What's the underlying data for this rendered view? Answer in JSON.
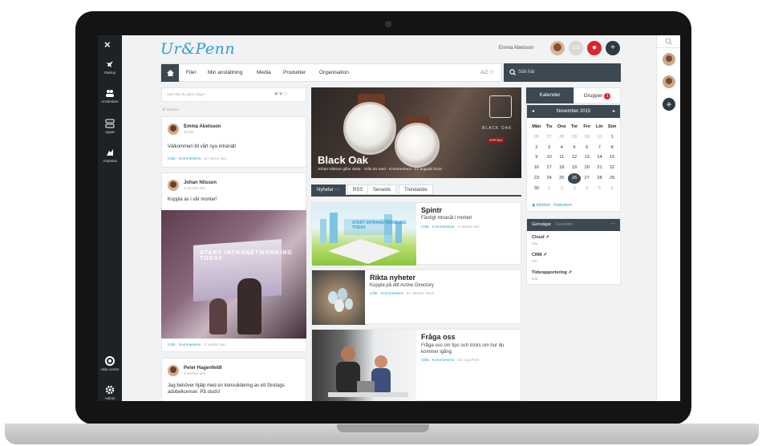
{
  "app": {
    "logo": "Ur&Penn"
  },
  "sidebar": {
    "close": "×",
    "items": [
      {
        "label": "Startup",
        "icon": "rocket-icon"
      },
      {
        "label": "Användare",
        "icon": "users-icon"
      },
      {
        "label": "Appar",
        "icon": "apps-icon"
      },
      {
        "label": "Anpassa",
        "icon": "customize-icon"
      },
      {
        "label": "Help center",
        "icon": "help-icon"
      },
      {
        "label": "Admin",
        "icon": "gear-icon"
      }
    ]
  },
  "header": {
    "user_name": "Emma Abelsson ·"
  },
  "nav": {
    "items": [
      "Filer",
      "Min anställning",
      "Media",
      "Produkter",
      "Organisation"
    ],
    "tools": "A/Z  ⚇",
    "search_placeholder": "Sök här"
  },
  "composer": {
    "placeholder": "Vad ska du göra idag?",
    "sort_label": "⇵ Sortera"
  },
  "posts": [
    {
      "author": "Emma Abelsson",
      "time": "14:58",
      "text": "Välkommen till vårt nya intranät!",
      "like": "Gilla",
      "comment": "Kommentera",
      "age": "en minut sen"
    },
    {
      "author": "Johan Nilsson",
      "time": "2 veckor sen",
      "text": "Koppla av i vår monter!",
      "like": "Gilla",
      "comment": "Kommentera",
      "age": "2 veckor sen",
      "photo_text": "START INTRANETWORKING TODAY"
    },
    {
      "author": "Peter Hagenfeldt",
      "time": "5 veckor sen",
      "text": "Jag behöver hjälp med en konsolidering av ett företags adobelicenser. På studs!"
    }
  ],
  "hero": {
    "title": "Black Oak",
    "caption": "Johan Nilsson gillar detta · Gilla du med · Kommentera · 21 augusti 2015",
    "brand": "BLACK OAK",
    "buy": "KÖP NU!"
  },
  "news_tabs": [
    {
      "label": "Nyheter ⋯",
      "active": true
    },
    {
      "label": "RSS",
      "active": false
    },
    {
      "label": "Senaste",
      "active": false
    },
    {
      "label": "Trendande",
      "active": false
    }
  ],
  "news": [
    {
      "title": "Spintr",
      "desc": "Färdigt intranät i molnet",
      "like": "Gilla",
      "comment": "Kommentera",
      "age": "2 veckor sen",
      "img_text": "START INTRANETWORKING TODAY"
    },
    {
      "title": "Rikta nyheter",
      "desc": "Koppla på ditt Active Directory",
      "like": "Gilla",
      "comment": "Kommentera",
      "age": "21 oktober 2015"
    },
    {
      "title": "Fråga oss",
      "desc": "Fråga oss om tips och tricks om hur du kommer igång",
      "like": "Gilla",
      "comment": "Kommentera",
      "age": "25 maj 2015"
    }
  ],
  "calendar": {
    "tab_calendar": "Kalender",
    "tab_groups": "Grupper",
    "groups_badge": "1",
    "month": "November 2015",
    "prev": "◂",
    "next": "▸",
    "weekdays": [
      "Mån",
      "Tis",
      "Ons",
      "Tor",
      "Fre",
      "Lör",
      "Sön"
    ],
    "weeks": [
      [
        "26",
        "27",
        "28",
        "29",
        "30",
        "31",
        "1"
      ],
      [
        "2",
        "3",
        "4",
        "5",
        "6",
        "7",
        "8"
      ],
      [
        "9",
        "10",
        "11",
        "12",
        "13",
        "14",
        "15"
      ],
      [
        "16",
        "17",
        "18",
        "19",
        "20",
        "21",
        "22"
      ],
      [
        "23",
        "24",
        "25",
        "26",
        "27",
        "28",
        "29"
      ],
      [
        "30",
        "1",
        "2",
        "3",
        "4",
        "5",
        "6"
      ]
    ],
    "today": "26",
    "footer": "◉ Aktivitet · Kalendern"
  },
  "shortcuts": {
    "tab_active": "Genvägar",
    "tab_other": "Favoriter",
    "more": "⋯",
    "items": [
      {
        "name": "Cloud ↗",
        "sub": "Mia"
      },
      {
        "name": "CRM ↗",
        "sub": "HR"
      },
      {
        "name": "Tidsrapportering ↗",
        "sub": "Mia"
      }
    ]
  },
  "colors": {
    "accent": "#2a9ed8",
    "dark": "#3c4852",
    "alert": "#d9262c"
  }
}
